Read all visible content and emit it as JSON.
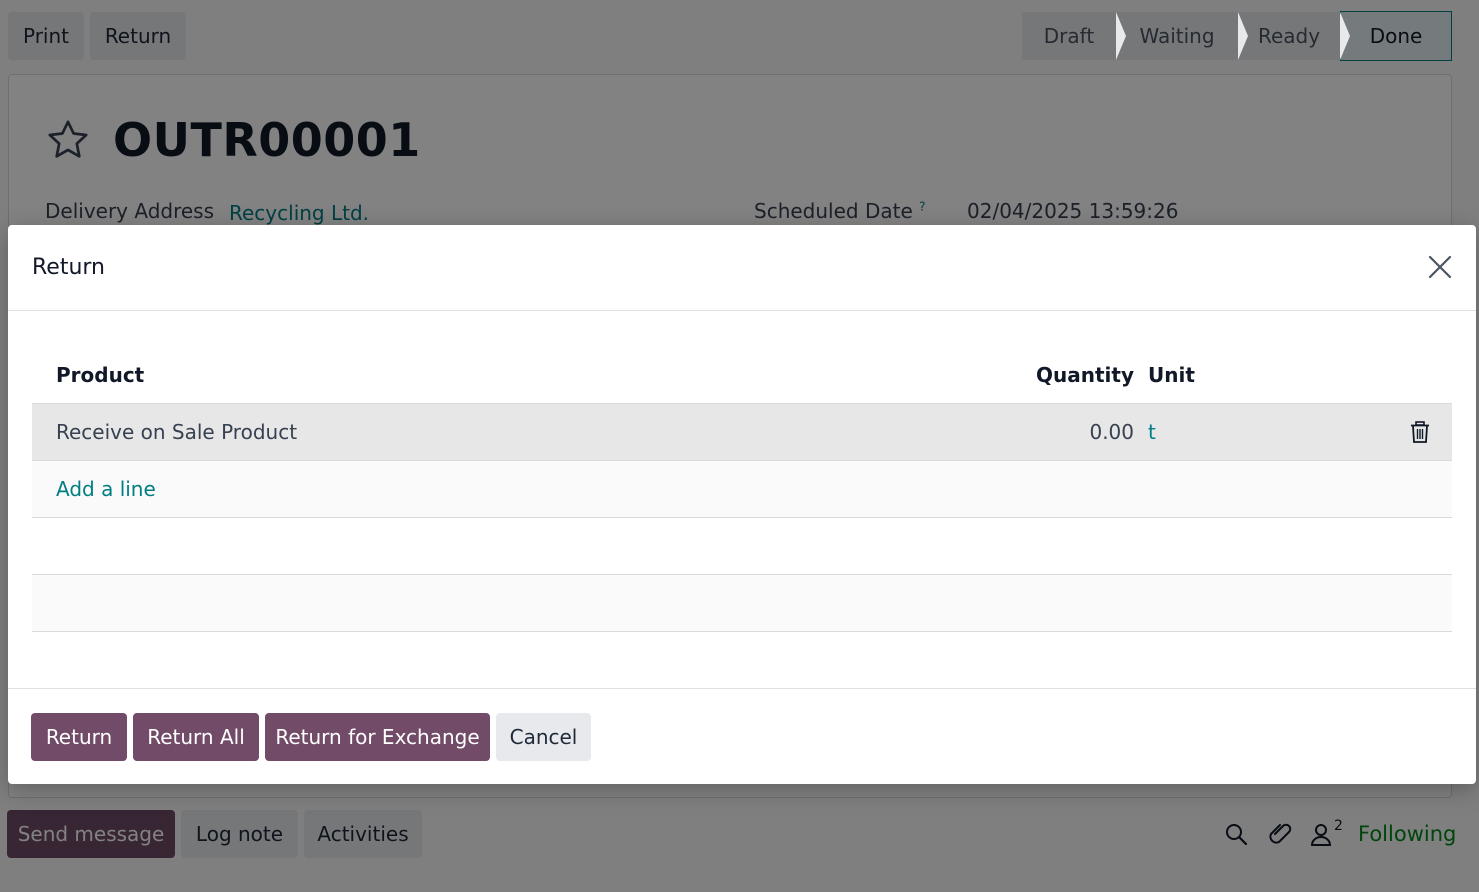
{
  "toolbar": {
    "print_label": "Print",
    "return_label": "Return"
  },
  "status_stages": [
    "Draft",
    "Waiting",
    "Ready",
    "Done"
  ],
  "record": {
    "name": "OUTR00001",
    "delivery_address_label": "Delivery Address",
    "delivery_address_value": "Recycling Ltd.",
    "scheduled_date_label": "Scheduled Date",
    "scheduled_date_help": "?",
    "scheduled_date_value": "02/04/2025 13:59:26"
  },
  "chatter": {
    "send_message": "Send message",
    "log_note": "Log note",
    "activities": "Activities",
    "followers_count": "2",
    "following_label": "Following"
  },
  "dialog": {
    "title": "Return",
    "columns": {
      "product": "Product",
      "quantity": "Quantity",
      "unit": "Unit"
    },
    "lines": [
      {
        "product": "Receive on Sale Product",
        "quantity": "0.00",
        "unit": "t"
      }
    ],
    "add_line": "Add a line",
    "buttons": {
      "return": "Return",
      "return_all": "Return All",
      "return_exchange": "Return for Exchange",
      "cancel": "Cancel"
    }
  },
  "colors": {
    "primary": "#714b67",
    "link": "#017e84",
    "following": "#008818"
  }
}
